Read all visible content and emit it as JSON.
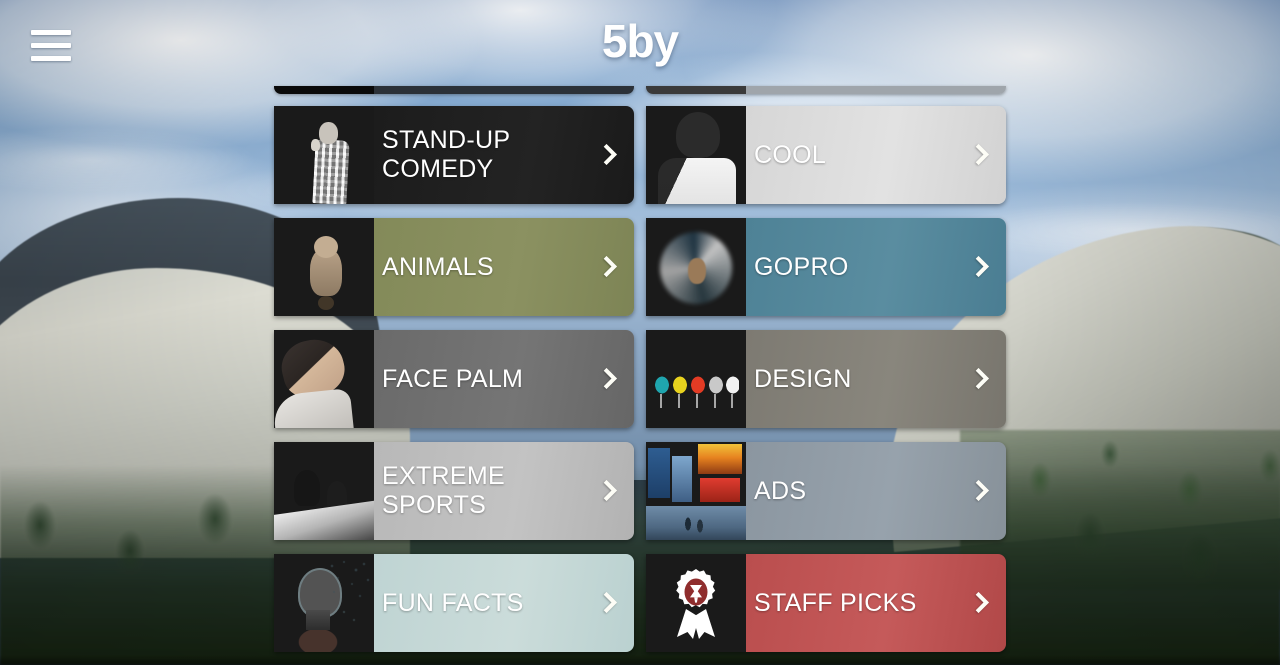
{
  "header": {
    "menu_icon": "hamburger-menu-icon",
    "logo_text": "5by"
  },
  "colors": {
    "staff_picks_red": "#ba4e4e",
    "staff_picks_icon_bg": "#8f2d2d",
    "gopro_teal": "#4e8296",
    "animals_olive": "#838a59",
    "fun_facts_mint": "#bfd4d3",
    "chevron": "#fdfdf6"
  },
  "grid": {
    "chevron_icon": "chevron-right-icon",
    "tiles": [
      {
        "id": "stand-up-comedy",
        "label": "STAND-UP COMEDY",
        "column": "left",
        "row": 0,
        "thumb_icon": "standup-comedian-thumbnail",
        "body_class": "body-standup",
        "thumb_class": "th-standup",
        "label_light": false
      },
      {
        "id": "cool",
        "label": "COOL",
        "column": "right",
        "row": 0,
        "thumb_icon": "man-with-sunglasses-thumbnail",
        "body_class": "body-cool",
        "thumb_class": "th-cool",
        "label_light": true
      },
      {
        "id": "animals",
        "label": "ANIMALS",
        "column": "left",
        "row": 1,
        "thumb_icon": "monkey-thumbnail",
        "body_class": "body-animals",
        "thumb_class": "th-animals",
        "label_light": false
      },
      {
        "id": "gopro",
        "label": "GOPRO",
        "column": "right",
        "row": 1,
        "thumb_icon": "surfer-wave-thumbnail",
        "body_class": "body-gopro",
        "thumb_class": "th-gopro",
        "label_light": false
      },
      {
        "id": "face-palm",
        "label": "FACE PALM",
        "column": "left",
        "row": 2,
        "thumb_icon": "man-facepalm-thumbnail",
        "body_class": "body-facepalm",
        "thumb_class": "th-facepalm",
        "label_light": false
      },
      {
        "id": "design",
        "label": "DESIGN",
        "column": "right",
        "row": 2,
        "thumb_icon": "colored-chairs-thumbnail",
        "body_class": "body-design",
        "thumb_class": "th-design",
        "label_light": false
      },
      {
        "id": "extreme-sports",
        "label": "EXTREME SPORTS",
        "column": "left",
        "row": 3,
        "thumb_icon": "bmx-riders-thumbnail",
        "body_class": "body-extreme",
        "thumb_class": "th-extreme",
        "label_light": true
      },
      {
        "id": "ads",
        "label": "ADS",
        "column": "right",
        "row": 3,
        "thumb_icon": "times-square-billboards-thumbnail",
        "body_class": "body-ads",
        "thumb_class": "th-ads",
        "label_light": false
      },
      {
        "id": "fun-facts",
        "label": "FUN FACTS",
        "column": "left",
        "row": 4,
        "thumb_icon": "lightbulb-letters-thumbnail",
        "body_class": "body-funfacts",
        "thumb_class": "th-funfacts",
        "label_light": true
      },
      {
        "id": "staff-picks",
        "label": "STAFF PICKS",
        "column": "right",
        "row": 4,
        "thumb_icon": "award-rosette-icon",
        "body_class": "body-staff",
        "thumb_class": "th-staff",
        "label_light": false
      }
    ]
  },
  "background": {
    "scene": "mountain-landscape-with-clouds"
  }
}
